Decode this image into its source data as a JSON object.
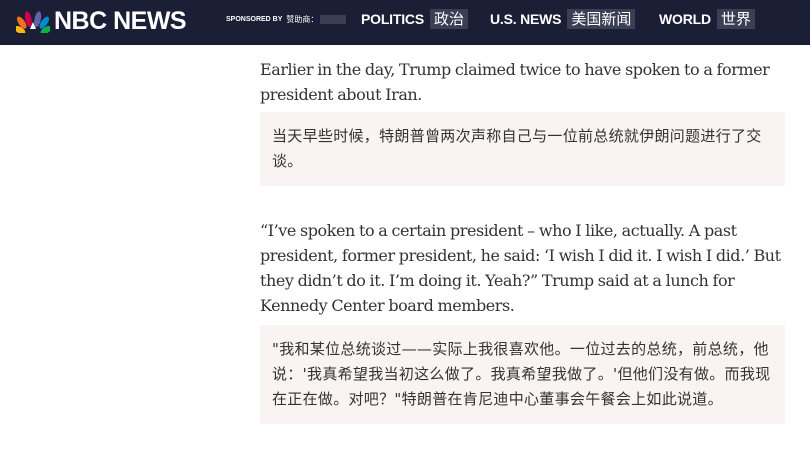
{
  "header": {
    "logo_text": "NBC NEWS",
    "sponsored_by_en": "SPONSORED BY",
    "sponsored_by_zh": "赞助商：",
    "nav": [
      {
        "en": "POLITICS",
        "zh": "政治"
      },
      {
        "en": "U.S. NEWS",
        "zh": "美国新闻"
      },
      {
        "en": "WORLD",
        "zh": "世界"
      }
    ]
  },
  "article": {
    "paragraphs": [
      {
        "original": "Earlier in the day, Trump claimed twice to have spoken to a former president about Iran.",
        "translation": "当天早些时候，特朗普曾两次声称自己与一位前总统就伊朗问题进行了交谈。"
      },
      {
        "original": "“I’ve spoken to a certain president – who I like, actually. A past president, former president, he said: ‘I wish I did it. I wish I did.’ But they didn’t do it. I’m doing it. Yeah?” Trump said at a lunch for Kennedy Center board members.",
        "translation": "\"我和某位总统谈过——实际上我很喜欢他。一位过去的总统，前总统，他说：'我真希望我当初这么做了。我真希望我做了。'但他们没有做。而我现在正在做。对吧？\"特朗普在肯尼迪中心董事会午餐会上如此说道。"
      }
    ]
  },
  "colors": {
    "navbar_bg": "#1a1f36",
    "nav_chip_bg": "#3a3f55",
    "translation_bg": "#faf3f3",
    "body_text": "#333333"
  }
}
